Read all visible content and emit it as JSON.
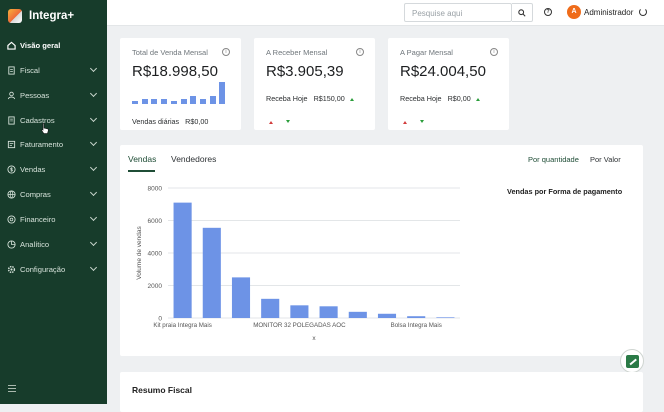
{
  "app": {
    "name": "Integra+"
  },
  "sidebar": {
    "items": [
      {
        "label": "Visão geral",
        "icon": "home-icon",
        "active": true,
        "has_children": false
      },
      {
        "label": "Fiscal",
        "icon": "receipt-icon",
        "active": false,
        "has_children": true
      },
      {
        "label": "Pessoas",
        "icon": "people-icon",
        "active": false,
        "has_children": true
      },
      {
        "label": "Cadastros",
        "icon": "document-icon",
        "active": false,
        "has_children": true
      },
      {
        "label": "Faturamento",
        "icon": "invoice-icon",
        "active": false,
        "has_children": true
      },
      {
        "label": "Vendas",
        "icon": "dollar-icon",
        "active": false,
        "has_children": true
      },
      {
        "label": "Compras",
        "icon": "globe-icon",
        "active": false,
        "has_children": true
      },
      {
        "label": "Financeiro",
        "icon": "money-icon",
        "active": false,
        "has_children": true
      },
      {
        "label": "Analítico",
        "icon": "analytics-icon",
        "active": false,
        "has_children": true
      },
      {
        "label": "Configuração",
        "icon": "gear-icon",
        "active": false,
        "has_children": true
      }
    ]
  },
  "topbar": {
    "search_placeholder": "Pesquise aqui",
    "user_initial": "A",
    "user_name": "Administrador"
  },
  "cards": [
    {
      "title": "Total de Venda Mensal",
      "value": "R$18.998,50",
      "sub_label": "Vendas diárias",
      "sub_value": "R$0,00",
      "mini_bars": [
        1,
        2,
        2,
        2,
        1,
        2,
        3,
        2,
        3,
        8
      ]
    },
    {
      "title": "A Receber Mensal",
      "value": "R$3.905,39",
      "sub_label": "Receba Hoje",
      "sub_value": "R$150,00"
    },
    {
      "title": "A Pagar Mensal",
      "value": "R$24.004,50",
      "sub_label": "Receba Hoje",
      "sub_value": "R$0,00"
    }
  ],
  "sales": {
    "tabs": [
      "Vendas",
      "Vendedores"
    ],
    "active_tab": "Vendas",
    "segments": [
      "Por quantidade",
      "Por Valor"
    ],
    "active_segment": "Por quantidade",
    "payment_title": "Vendas por Forma de pagamento"
  },
  "chart_data": {
    "type": "bar",
    "categories": [
      "Kit praia Integra Mais",
      "",
      "",
      "",
      "MONITOR 32 POLEGADAS AOC",
      "",
      "",
      "",
      "Bolsa Integra Mais",
      ""
    ],
    "values": [
      7100,
      5550,
      2500,
      1180,
      780,
      720,
      380,
      260,
      110,
      40
    ],
    "ylabel": "Volume de vendas",
    "xlabel": "x",
    "ylim": [
      0,
      8000
    ],
    "yticks": [
      "0",
      "2000",
      "4000",
      "6000",
      "8000"
    ],
    "bar_color": "#6d93e6",
    "grid": true
  },
  "resumo_fiscal": {
    "title": "Resumo Fiscal"
  },
  "colors": {
    "sidebar": "#173c2b",
    "accent": "#1f4d36",
    "avatar": "#ef6c1a",
    "bar": "#6d93e6"
  }
}
